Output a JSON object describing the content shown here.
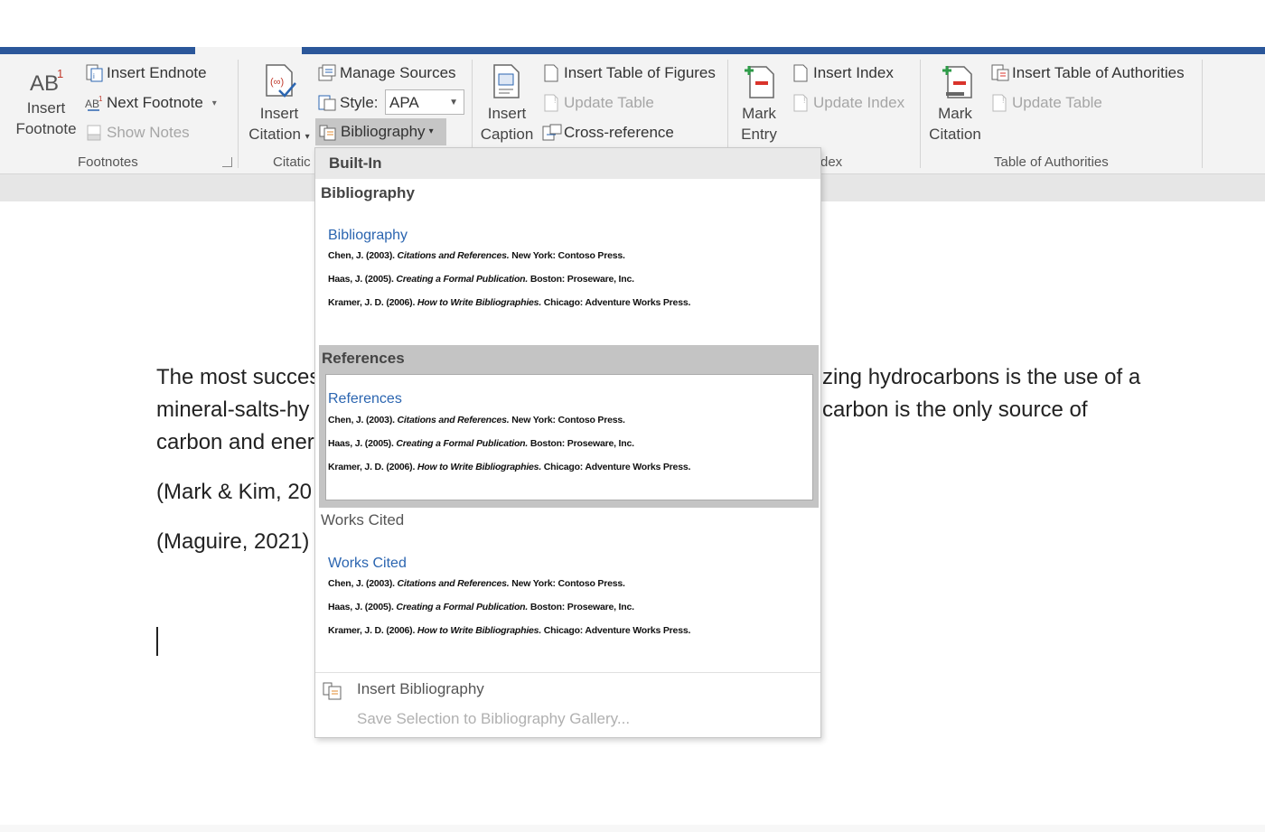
{
  "ribbon": {
    "footnotes": {
      "insert_footnote_line1": "Insert",
      "insert_footnote_line2": "Footnote",
      "insert_endnote": "Insert Endnote",
      "next_footnote": "Next Footnote",
      "show_notes": "Show Notes",
      "group_label": "Footnotes"
    },
    "citations": {
      "insert_citation_line1": "Insert",
      "insert_citation_line2": "Citation",
      "manage_sources": "Manage Sources",
      "style_label": "Style:",
      "style_value": "APA",
      "bibliography": "Bibliography",
      "group_label": "Citatic"
    },
    "captions": {
      "insert_caption_line1": "Insert",
      "insert_caption_line2": "Caption",
      "insert_table_of_figures": "Insert Table of Figures",
      "update_table": "Update Table",
      "cross_reference": "Cross-reference"
    },
    "index": {
      "mark_entry_line1": "Mark",
      "mark_entry_line2": "Entry",
      "insert_index": "Insert Index",
      "update_index": "Update Index",
      "group_label": "dex"
    },
    "authorities": {
      "mark_citation_line1": "Mark",
      "mark_citation_line2": "Citation",
      "insert_table_of_authorities": "Insert Table of Authorities",
      "update_table": "Update Table",
      "group_label": "Table of Authorities"
    }
  },
  "document": {
    "line1_left": "The most succes",
    "line1_right": "zing hydrocarbons is the use of a",
    "line2_left": "mineral-salts-hy",
    "line2_right": "carbon is the only source of",
    "line3_left": "carbon and ener",
    "citation1": "(Mark & Kim, 20",
    "citation2": "(Maguire, 2021)"
  },
  "dropdown": {
    "builtin": "Built-In",
    "sections": [
      {
        "heading": "Bibliography",
        "title": "Bibliography",
        "entries": [
          {
            "plain": "Chen, J. (2003). ",
            "ital": "Citations and References.",
            "rest": " New York: Contoso Press."
          },
          {
            "plain": "Haas, J. (2005). ",
            "ital": "Creating a Formal Publication.",
            "rest": " Boston: Proseware, Inc."
          },
          {
            "plain": "Kramer, J. D. (2006). ",
            "ital": "How to Write Bibliographies.",
            "rest": " Chicago: Adventure Works Press."
          }
        ]
      },
      {
        "heading": "References",
        "title": "References",
        "entries": [
          {
            "plain": "Chen, J. (2003). ",
            "ital": "Citations and References.",
            "rest": " New York: Contoso Press."
          },
          {
            "plain": "Haas, J. (2005). ",
            "ital": "Creating a Formal Publication.",
            "rest": " Boston: Proseware, Inc."
          },
          {
            "plain": "Kramer, J. D. (2006). ",
            "ital": "How to Write Bibliographies.",
            "rest": " Chicago: Adventure Works Press."
          }
        ]
      },
      {
        "heading": "Works Cited",
        "title": "Works Cited",
        "entries": [
          {
            "plain": "Chen, J. (2003). ",
            "ital": "Citations and References.",
            "rest": " New York: Contoso Press."
          },
          {
            "plain": "Haas, J. (2005). ",
            "ital": "Creating a Formal Publication.",
            "rest": " Boston: Proseware, Inc."
          },
          {
            "plain": "Kramer, J. D. (2006). ",
            "ital": "How to Write Bibliographies.",
            "rest": " Chicago: Adventure Works Press."
          }
        ]
      }
    ],
    "insert_bibliography": "Insert Bibliography",
    "save_selection": "Save Selection to Bibliography Gallery..."
  },
  "colors": {
    "title_bar": "#2b579a",
    "gallery_title": "#2b65b0",
    "selected_section": "#c4c4c4"
  }
}
